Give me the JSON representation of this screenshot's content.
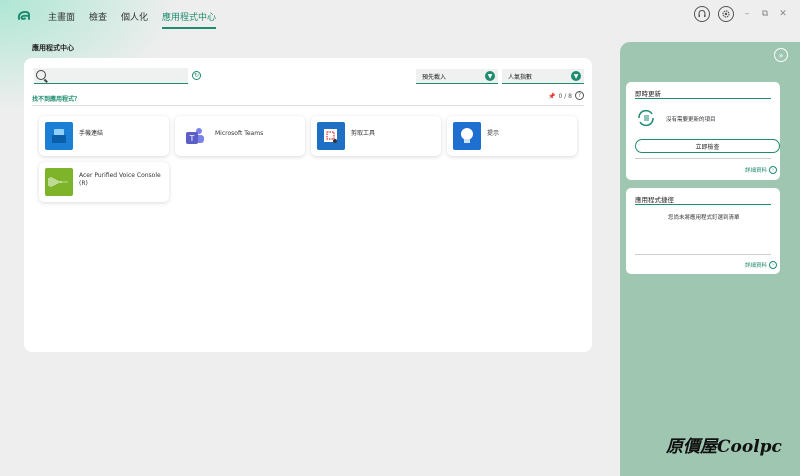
{
  "nav": {
    "items": [
      "主畫面",
      "檢查",
      "個人化",
      "應用程式中心"
    ],
    "active_index": 3
  },
  "page_title": "應用程式中心",
  "search": {
    "placeholder": "",
    "value": ""
  },
  "filters": {
    "sort": "預先載入",
    "rating": "人氣指數"
  },
  "missing_link": "找不到應用程式？",
  "pin_count": "0 / 8",
  "apps": [
    {
      "name": "手機連結",
      "icon": "phone-link-icon",
      "color": "#1b7fd6"
    },
    {
      "name": "Microsoft Teams",
      "icon": "teams-icon",
      "color": "#5b5fc7"
    },
    {
      "name": "剪取工具",
      "icon": "snipping-tool-icon",
      "color": "#1f6fc4"
    },
    {
      "name": "提示",
      "icon": "tips-bulb-icon",
      "color": "#1e6fd0"
    },
    {
      "name": "Acer Purified Voice Console (R)",
      "icon": "voice-wave-icon",
      "color": "#7db42a"
    }
  ],
  "update_card": {
    "title": "即時更新",
    "status": "沒有需要更新的項目",
    "button": "立即檢查",
    "detail": "詳細資料"
  },
  "shortcut_card": {
    "title": "應用程式捷徑",
    "status": "您尚未將應用程式釘選到清單",
    "detail": "詳細資料"
  },
  "watermark": "原價屋Coolpc",
  "accent": "#1e8c6e"
}
